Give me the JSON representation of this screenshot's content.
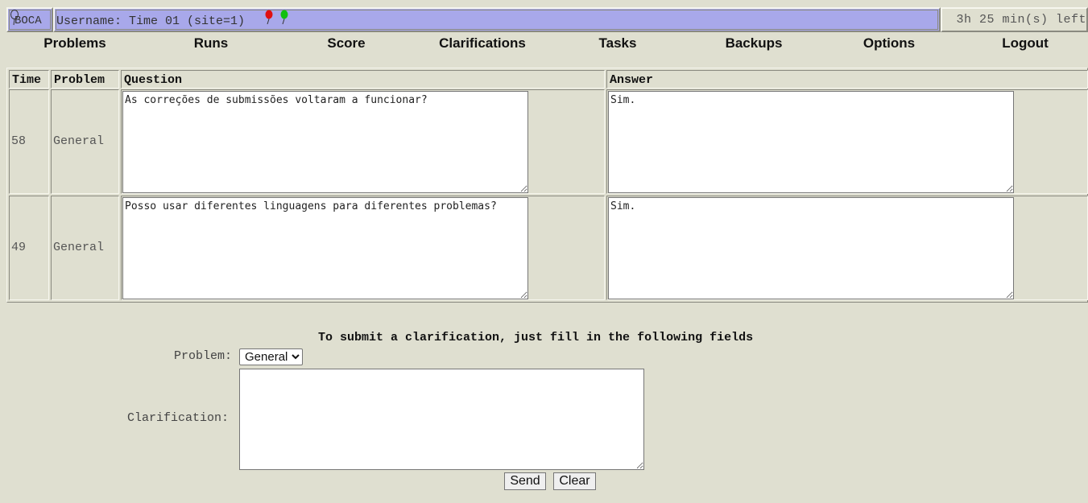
{
  "header": {
    "logo_text": "BOCA",
    "username_text": "Username: Time 01 (site=1)",
    "time_left": "3h 25 min(s) left",
    "balloons": [
      {
        "name": "red-balloon-icon",
        "color": "#e01010"
      },
      {
        "name": "green-balloon-icon",
        "color": "#10c010"
      }
    ]
  },
  "nav": [
    {
      "label": "Problems"
    },
    {
      "label": "Runs"
    },
    {
      "label": "Score"
    },
    {
      "label": "Clarifications"
    },
    {
      "label": "Tasks"
    },
    {
      "label": "Backups"
    },
    {
      "label": "Options"
    },
    {
      "label": "Logout"
    }
  ],
  "table": {
    "headers": {
      "time": "Time",
      "problem": "Problem",
      "question": "Question",
      "answer": "Answer"
    },
    "rows": [
      {
        "time": "58",
        "problem": "General",
        "question": "As correções de submissões voltaram a funcionar?",
        "answer": "Sim."
      },
      {
        "time": "49",
        "problem": "General",
        "question": "Posso usar diferentes linguagens para diferentes problemas?",
        "answer": "Sim."
      }
    ]
  },
  "form": {
    "title": "To submit a clarification, just fill in the following fields",
    "problem_label": "Problem:",
    "problem_selected": "General",
    "clarification_label": "Clarification:",
    "clarification_value": "",
    "send_label": "Send",
    "clear_label": "Clear"
  }
}
